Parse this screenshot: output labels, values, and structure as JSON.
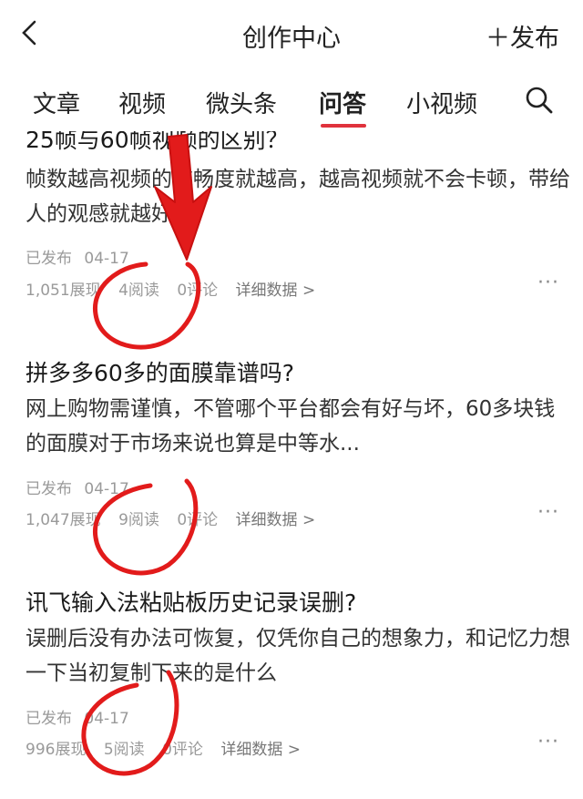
{
  "header": {
    "title": "创作中心",
    "publish_label": "＋发布"
  },
  "tabs": [
    {
      "label": "文章",
      "active": false
    },
    {
      "label": "视频",
      "active": false
    },
    {
      "label": "微头条",
      "active": false
    },
    {
      "label": "问答",
      "active": true
    },
    {
      "label": "小视频",
      "active": false
    }
  ],
  "questions": [
    {
      "title": "25帧与60帧视频的区别？",
      "body": "帧数越高视频的流畅度就越高，越高视频就不会卡顿，带给人的观感就越好。",
      "status": "已发布",
      "date": "04-17",
      "views": "1,051展现",
      "reads": "4阅读",
      "comments": "0评论",
      "detail": "详细数据 >",
      "more": "···"
    },
    {
      "title": "拼多多60多的面膜靠谱吗?",
      "body": "网上购物需谨慎，不管哪个平台都会有好与坏，60多块钱的面膜对于市场来说也算是中等水...",
      "status": "已发布",
      "date": "04-17",
      "views": "1,047展现",
      "reads": "9阅读",
      "comments": "0评论",
      "detail": "详细数据 >",
      "more": "···"
    },
    {
      "title": "讯飞输入法粘贴板历史记录误删?",
      "body": "误删后没有办法可恢复，仅凭你自己的想象力，和记忆力想一下当初复制下来的是什么",
      "status": "已发布",
      "date": "04-17",
      "views": "996展现",
      "reads": "5阅读",
      "comments": "0评论",
      "detail": "详细数据 >",
      "more": "···"
    }
  ],
  "annotation_color": "#e21b1b",
  "accent_color": "#e0323c",
  "icons": [
    "back-arrow-icon",
    "search-icon",
    "more-icon"
  ]
}
